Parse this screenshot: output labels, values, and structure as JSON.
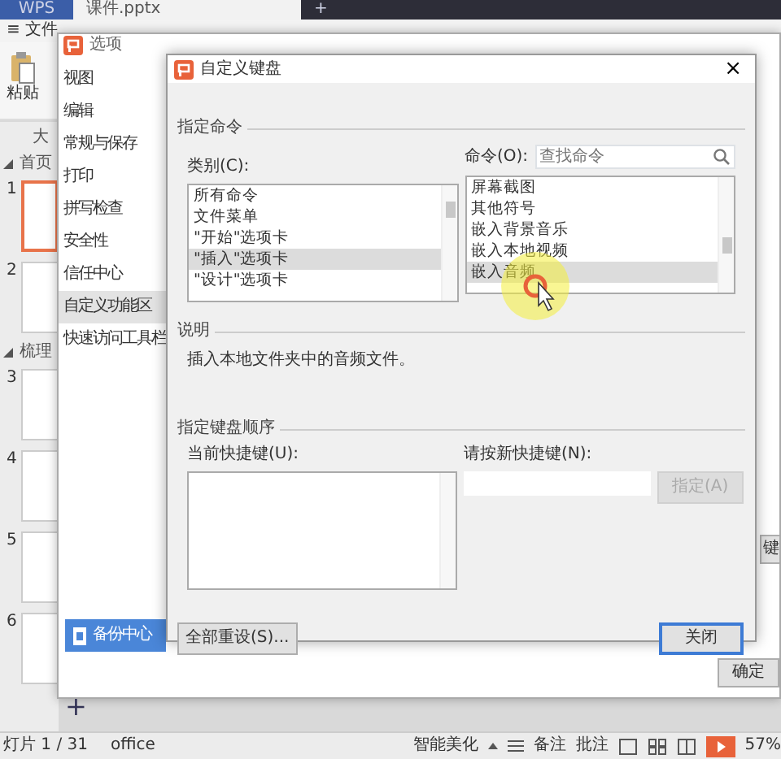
{
  "app_tabs": [
    {
      "label": "WPS",
      "selected": false
    },
    {
      "label": "课件.pptx",
      "selected": true
    }
  ],
  "new_tab": "+",
  "menu": {
    "icon": "≡",
    "label": "文件"
  },
  "ribbon": {
    "paste": "粘贴"
  },
  "panel_tab": "大",
  "sections": [
    {
      "label": "首页",
      "slides": [
        {
          "number": "1",
          "selected": true
        },
        {
          "number": "2",
          "selected": false
        }
      ]
    },
    {
      "label": "梳理",
      "slides": [
        {
          "number": "3",
          "selected": false
        },
        {
          "number": "4",
          "selected": false
        },
        {
          "number": "5",
          "selected": false
        },
        {
          "number": "6",
          "selected": false
        }
      ]
    }
  ],
  "add_slide": "+",
  "status_bar": {
    "slide_info": "灯片 1 / 31",
    "theme": "office",
    "beautify": "智能美化",
    "notes": "备注",
    "comments": "批注",
    "zoom": "57%"
  },
  "options": {
    "title": "选项",
    "nav": [
      {
        "label": "视图",
        "selected": false
      },
      {
        "label": "编辑",
        "selected": false
      },
      {
        "label": "常规与保存",
        "selected": false
      },
      {
        "label": "打印",
        "selected": false
      },
      {
        "label": "拼写检查",
        "selected": false
      },
      {
        "label": "安全性",
        "selected": false
      },
      {
        "label": "信任中心",
        "selected": false
      },
      {
        "label": "自定义功能区",
        "selected": true
      },
      {
        "label": "快速访问工具栏",
        "selected": false
      }
    ],
    "backup": "备份中心",
    "rename": "键",
    "ok": "确定"
  },
  "dialog": {
    "title": "自定义键盘",
    "close": "×",
    "command_group": "指定命令",
    "category_label": "类别(C):",
    "categories": [
      {
        "label": "所有命令",
        "selected": false
      },
      {
        "label": "文件菜单",
        "selected": false
      },
      {
        "label": "\"开始\"选项卡",
        "selected": false
      },
      {
        "label": "\"插入\"选项卡",
        "selected": true
      },
      {
        "label": "\"设计\"选项卡",
        "selected": false
      }
    ],
    "command_label": "命令(O):",
    "search_placeholder": "查找命令",
    "commands": [
      {
        "label": "屏幕截图",
        "selected": false
      },
      {
        "label": "其他符号",
        "selected": false
      },
      {
        "label": "嵌入背景音乐",
        "selected": false
      },
      {
        "label": "嵌入本地视频",
        "selected": false
      },
      {
        "label": "嵌入音频",
        "selected": true
      }
    ],
    "description_group": "说明",
    "description": "插入本地文件夹中的音频文件。",
    "keys_group": "指定键盘顺序",
    "current_keys_label": "当前快捷键(U):",
    "new_key_label": "请按新快捷键(N):",
    "assign": {
      "label": "指定(A)",
      "disabled": true
    },
    "reset": "全部重设(S)...",
    "close_button": "关闭"
  }
}
